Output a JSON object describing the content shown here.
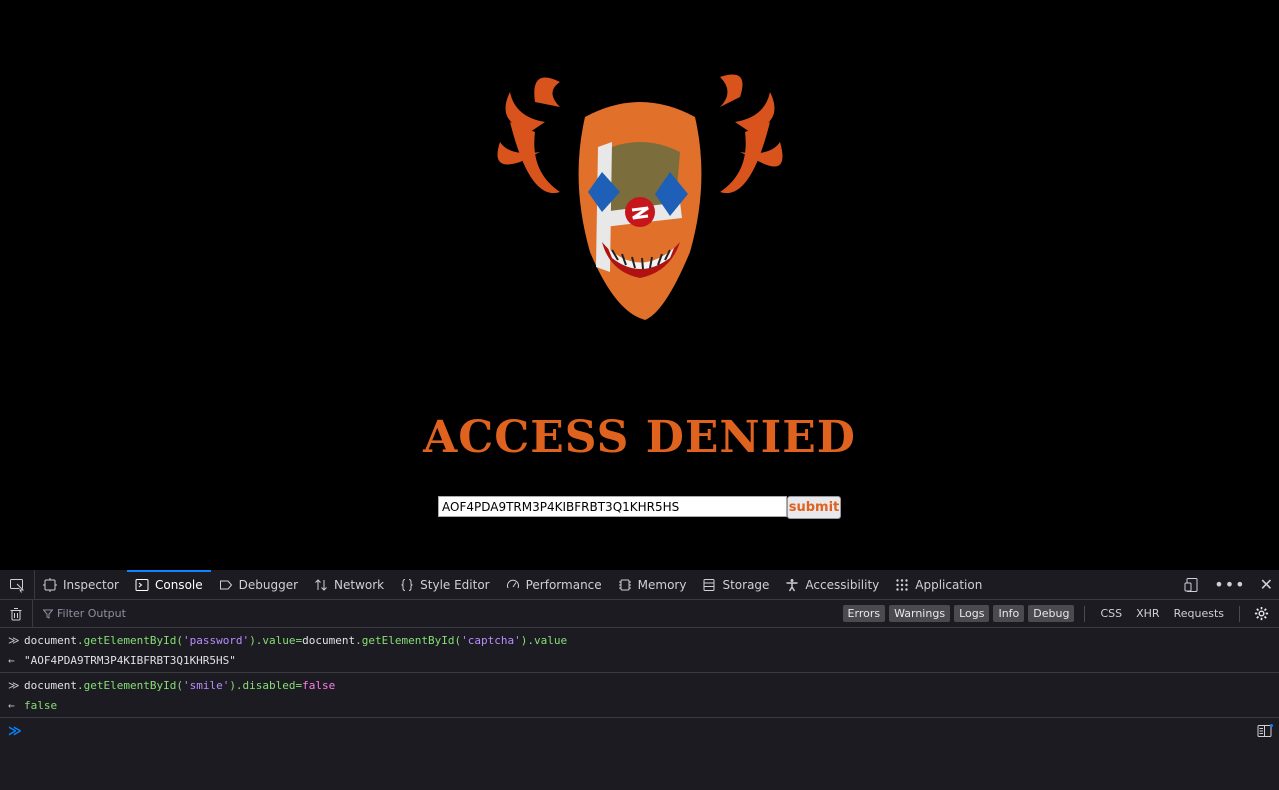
{
  "page": {
    "title": "ACCESS DENIED",
    "input_value": "AOF4PDA9TRM3P4KIBFRBT3Q1KHR5HS",
    "submit_label": "submit",
    "accent_color": "#e0621f"
  },
  "devtools": {
    "tabs": [
      {
        "label": "Inspector",
        "icon": "inspector-icon"
      },
      {
        "label": "Console",
        "icon": "console-icon",
        "active": true
      },
      {
        "label": "Debugger",
        "icon": "debugger-icon"
      },
      {
        "label": "Network",
        "icon": "network-icon"
      },
      {
        "label": "Style Editor",
        "icon": "style-editor-icon"
      },
      {
        "label": "Performance",
        "icon": "performance-icon"
      },
      {
        "label": "Memory",
        "icon": "memory-icon"
      },
      {
        "label": "Storage",
        "icon": "storage-icon"
      },
      {
        "label": "Accessibility",
        "icon": "accessibility-icon"
      },
      {
        "label": "Application",
        "icon": "application-icon"
      }
    ],
    "filter_placeholder": "Filter Output",
    "levels": [
      "Errors",
      "Warnings",
      "Logs",
      "Info",
      "Debug"
    ],
    "extra_filters": [
      "CSS",
      "XHR",
      "Requests"
    ],
    "console": [
      {
        "input_parts": [
          "document",
          ".getElementById(",
          "'password'",
          ").value=",
          "document",
          ".getElementById(",
          "'captcha'",
          ").value"
        ],
        "output": "\"AOF4PDA9TRM3P4KIBFRBT3Q1KHR5HS\""
      },
      {
        "input_parts": [
          "document",
          ".getElementById(",
          "'smile'",
          ").disabled=",
          "false"
        ],
        "output": "false"
      }
    ]
  }
}
